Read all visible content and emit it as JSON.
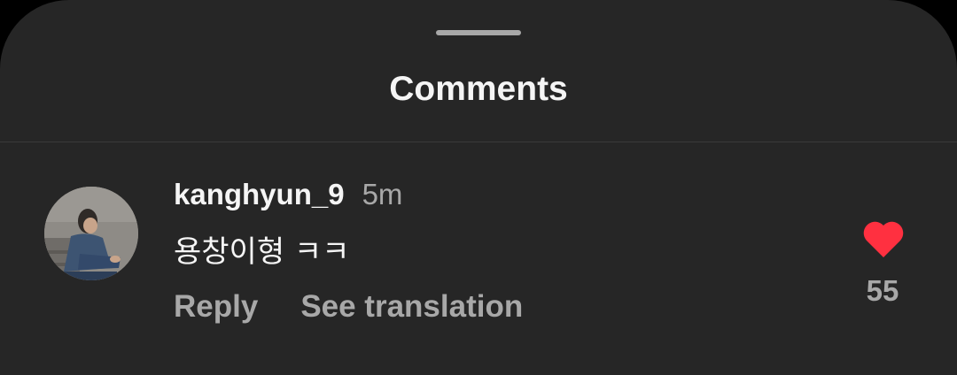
{
  "header": {
    "title": "Comments"
  },
  "comment": {
    "username": "kanghyun_9",
    "time": "5m",
    "text": "용창이형 ㅋㅋ",
    "reply_label": "Reply",
    "translate_label": "See translation",
    "like_count": "55",
    "liked": true
  },
  "icons": {
    "like": "heart-icon",
    "avatar": "profile-photo"
  },
  "colors": {
    "sheet_background": "#262626",
    "primary_text": "#f5f5f5",
    "secondary_text": "#a8a8a8",
    "like_red": "#ff3040"
  }
}
